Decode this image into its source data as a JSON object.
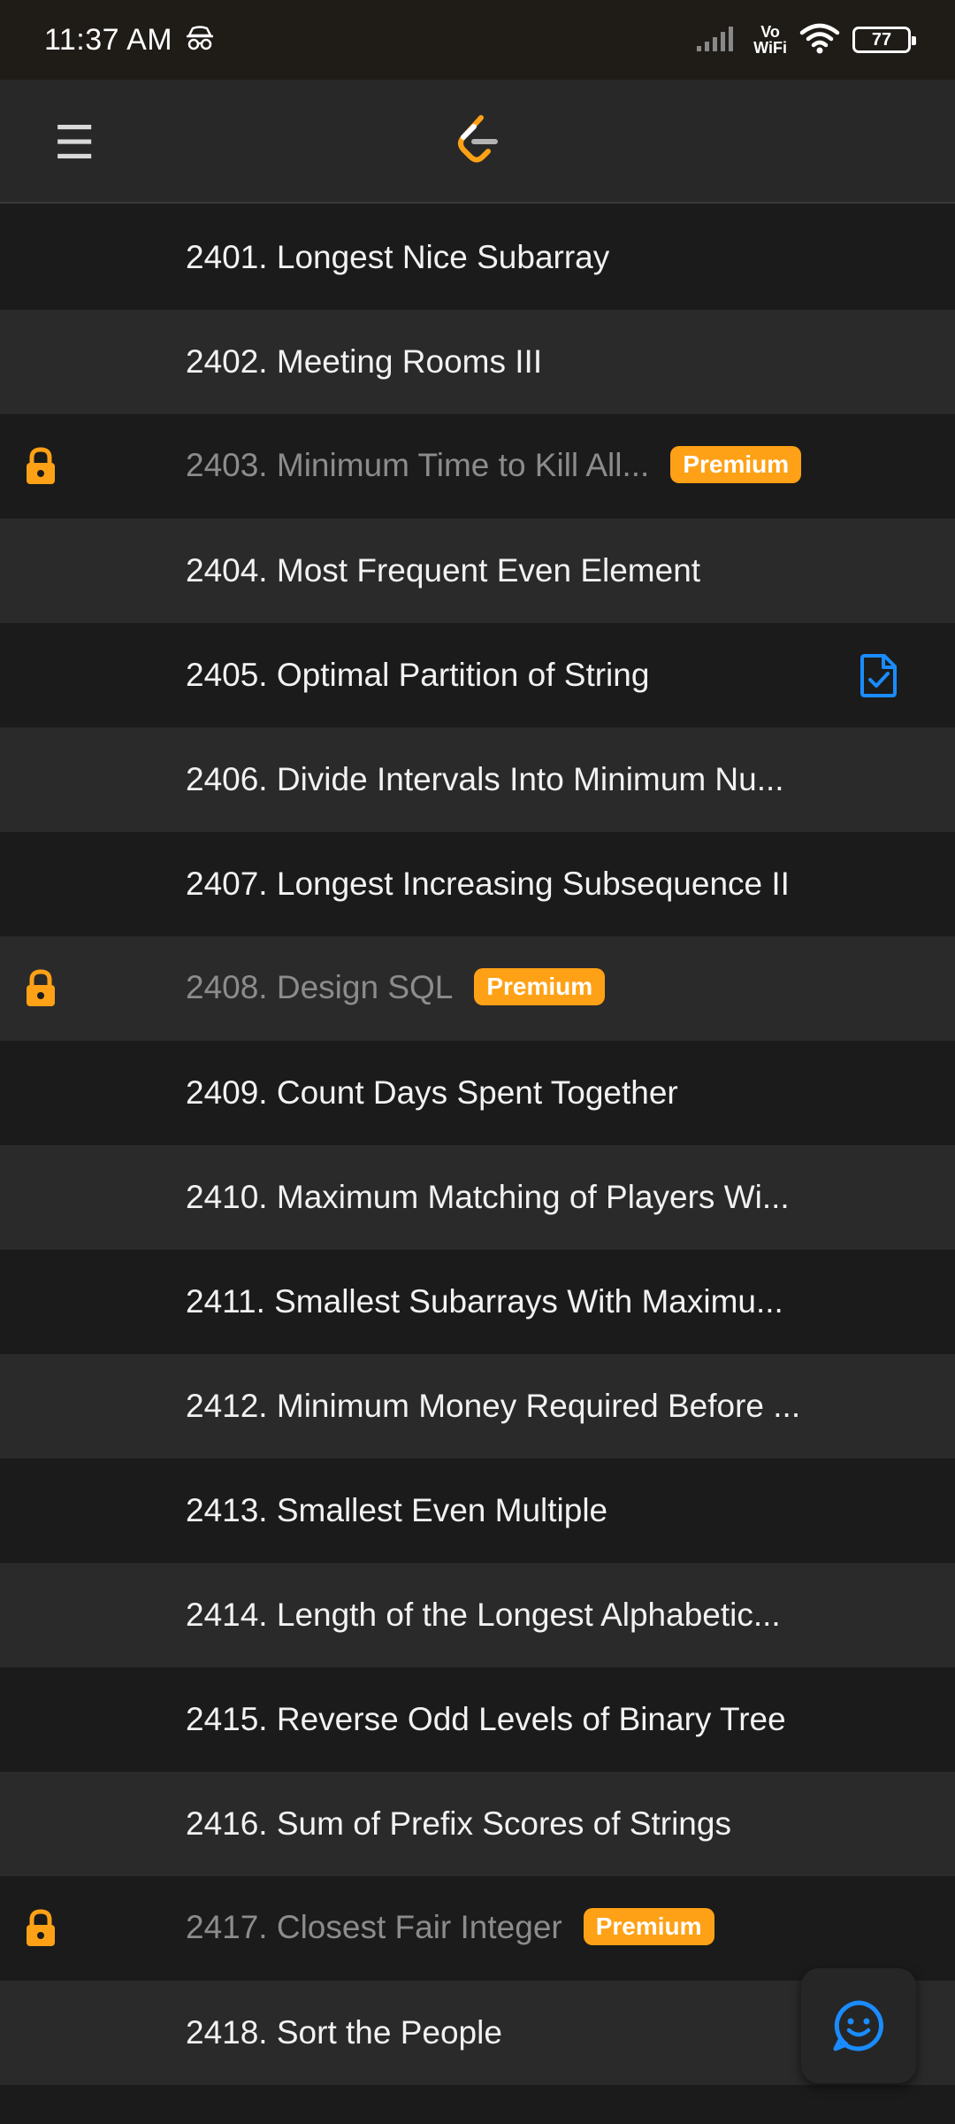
{
  "status_bar": {
    "time": "11:37 AM",
    "vo_label": "Vo",
    "wifi_label": "WiFi",
    "battery": "77"
  },
  "app_bar": {
    "menu_glyph": "☰"
  },
  "colors": {
    "accent": "#ffa116",
    "solved_blue": "#1a8cff",
    "row_dark": "#1b1b1b",
    "row_light": "#2a2a2a"
  },
  "premium_label": "Premium",
  "problems": [
    {
      "title": "2401. Longest Nice Subarray"
    },
    {
      "title": "2402. Meeting Rooms III"
    },
    {
      "title": "2403. Minimum Time to Kill All...",
      "premium": true
    },
    {
      "title": "2404. Most Frequent Even Element"
    },
    {
      "title": "2405. Optimal Partition of String",
      "solved": true
    },
    {
      "title": "2406. Divide Intervals Into Minimum Nu..."
    },
    {
      "title": "2407. Longest Increasing Subsequence II"
    },
    {
      "title": "2408. Design SQL",
      "premium": true
    },
    {
      "title": "2409. Count Days Spent Together"
    },
    {
      "title": "2410. Maximum Matching of Players Wi..."
    },
    {
      "title": "2411. Smallest Subarrays With Maximu..."
    },
    {
      "title": "2412. Minimum Money Required Before ..."
    },
    {
      "title": "2413. Smallest Even Multiple"
    },
    {
      "title": "2414. Length of the Longest Alphabetic..."
    },
    {
      "title": "2415. Reverse Odd Levels of Binary Tree"
    },
    {
      "title": "2416. Sum of Prefix Scores of Strings"
    },
    {
      "title": "2417. Closest Fair Integer",
      "premium": true
    },
    {
      "title": "2418. Sort the People"
    }
  ]
}
